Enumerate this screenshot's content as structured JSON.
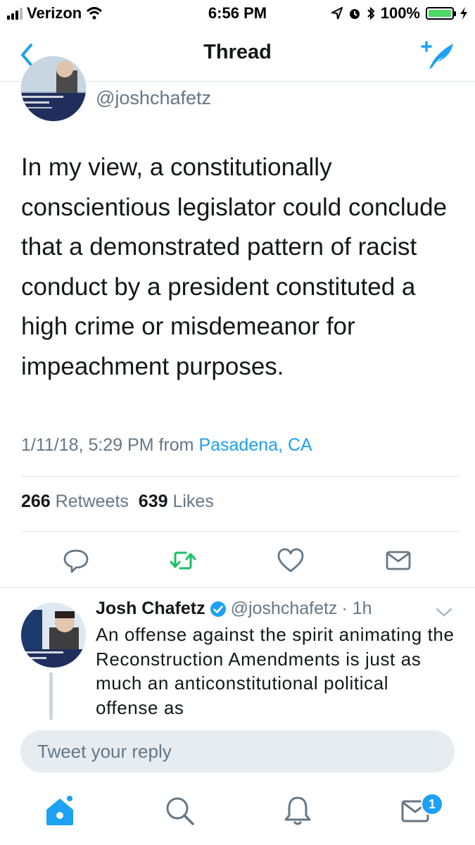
{
  "status_bar": {
    "carrier": "Verizon",
    "time": "6:56 PM",
    "battery": "100%",
    "battery_level": 1.0
  },
  "nav": {
    "title": "Thread"
  },
  "main_tweet": {
    "handle": "@joshchafetz",
    "text": "In my view, a constitutionally conscientious legislator could conclude that a demonstrated pattern of racist conduct by a president constituted a high crime or misdemeanor for impeachment purposes.",
    "timestamp": "1/11/18, 5:29 PM from",
    "location": "Pasadena, CA",
    "retweet_count": "266",
    "retweet_label": "Retweets",
    "like_count": "639",
    "like_label": "Likes"
  },
  "reply_tweet": {
    "name": "Josh Chafetz",
    "handle": "@joshchafetz",
    "time": "· 1h",
    "text": "An offense against the spirit animating the Reconstruction Amendments is just as much an anticonstitutional political offense as"
  },
  "reply_bar": {
    "placeholder": "Tweet your reply"
  },
  "tab_bar": {
    "dm_badge": "1"
  },
  "colors": {
    "accent": "#1da1f2",
    "retweet_green": "#17bf63",
    "secondary_text": "#657786",
    "battery_green": "#4cd964"
  },
  "icons": [
    "signal-icon",
    "wifi-icon",
    "location-icon",
    "alarm-icon",
    "bluetooth-icon",
    "battery-icon",
    "charging-icon",
    "back-chevron-icon",
    "compose-icon",
    "verified-badge-icon",
    "reply-icon",
    "retweet-icon",
    "like-heart-icon",
    "share-mail-icon",
    "chevron-down-icon",
    "home-icon",
    "search-icon",
    "notifications-bell-icon",
    "messages-mail-icon"
  ]
}
